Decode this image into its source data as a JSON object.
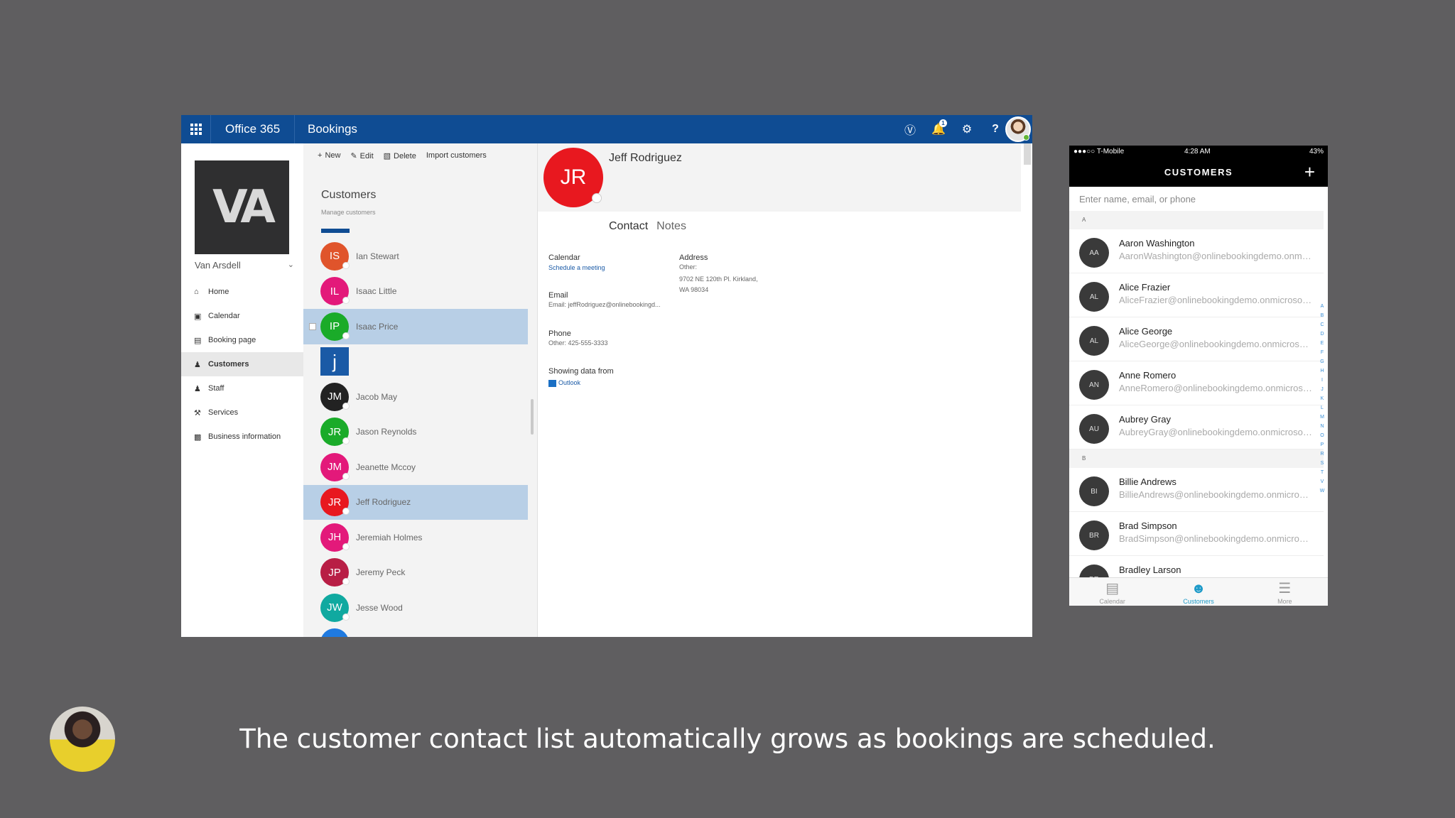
{
  "topbar": {
    "app_name": "Office 365",
    "service_name": "Bookings",
    "notifications_count": "1",
    "icons": [
      "skype-icon",
      "bell-icon",
      "gear-icon",
      "help-icon"
    ]
  },
  "business": {
    "logo_text": "VA",
    "name": "Van Arsdell"
  },
  "nav": {
    "items": [
      {
        "label": "Home",
        "icon": "home-icon"
      },
      {
        "label": "Calendar",
        "icon": "calendar-icon"
      },
      {
        "label": "Booking page",
        "icon": "booking-page-icon"
      },
      {
        "label": "Customers",
        "icon": "customers-icon",
        "active": true
      },
      {
        "label": "Staff",
        "icon": "staff-icon"
      },
      {
        "label": "Services",
        "icon": "services-icon"
      },
      {
        "label": "Business information",
        "icon": "business-info-icon"
      }
    ]
  },
  "commands": {
    "new": "New",
    "edit": "Edit",
    "delete": "Delete",
    "import": "Import customers"
  },
  "customer_list": {
    "title": "Customers",
    "subtitle": "Manage customers",
    "rows": [
      {
        "initials": "IS",
        "name": "Ian Stewart",
        "color": "#e0542b"
      },
      {
        "initials": "IL",
        "name": "Isaac Little",
        "color": "#e3197a"
      },
      {
        "initials": "IP",
        "name": "Isaac Price",
        "color": "#1aab29",
        "selected": true
      },
      {
        "letter": "j"
      },
      {
        "initials": "JM",
        "name": "Jacob May",
        "color": "#222222"
      },
      {
        "initials": "JR",
        "name": "Jason Reynolds",
        "color": "#1aab29"
      },
      {
        "initials": "JM",
        "name": "Jeanette Mccoy",
        "color": "#e3197a"
      },
      {
        "initials": "JR",
        "name": "Jeff Rodriguez",
        "color": "#e8181f",
        "selected": true
      },
      {
        "initials": "JH",
        "name": "Jeremiah Holmes",
        "color": "#e3197a"
      },
      {
        "initials": "JP",
        "name": "Jeremy Peck",
        "color": "#b81e45"
      },
      {
        "initials": "JW",
        "name": "Jesse Wood",
        "color": "#10a9a0"
      }
    ]
  },
  "detail": {
    "initials": "JR",
    "name": "Jeff Rodriguez",
    "tabs": [
      "Contact",
      "Notes"
    ],
    "calendar_label": "Calendar",
    "calendar_link": "Schedule a meeting",
    "address_label": "Address",
    "address_type": "Other:",
    "address_line1": "9702 NE 120th Pl. Kirkland,",
    "address_line2": "WA 98034",
    "email_label": "Email",
    "email_value": "Email: jeffRodriguez@onlinebookingd...",
    "phone_label": "Phone",
    "phone_value": "Other: 425-555-3333",
    "source_label": "Showing data from",
    "source_value": "Outlook"
  },
  "phone": {
    "carrier": "T-Mobile",
    "time": "4:28 AM",
    "battery": "43%",
    "title": "CUSTOMERS",
    "add": "+",
    "search_placeholder": "Enter name, email, or phone",
    "sections": [
      {
        "letter": "A",
        "rows": [
          {
            "initials": "AA",
            "name": "Aaron Washington",
            "email": "AaronWashington@onlinebookingdemo.onmicrosoft.com"
          },
          {
            "initials": "AL",
            "name": "Alice Frazier",
            "email": "AliceFrazier@onlinebookingdemo.onmicrosoft.com"
          },
          {
            "initials": "AL",
            "name": "Alice George",
            "email": "AliceGeorge@onlinebookingdemo.onmicrosoft.com"
          },
          {
            "initials": "AN",
            "name": "Anne Romero",
            "email": "AnneRomero@onlinebookingdemo.onmicrosoft.com"
          },
          {
            "initials": "AU",
            "name": "Aubrey Gray",
            "email": "AubreyGray@onlinebookingdemo.onmicrosoft.com"
          }
        ]
      },
      {
        "letter": "B",
        "rows": [
          {
            "initials": "BI",
            "name": "Billie Andrews",
            "email": "BillieAndrews@onlinebookingdemo.onmicrosoft.com"
          },
          {
            "initials": "BR",
            "name": "Brad Simpson",
            "email": "BradSimpson@onlinebookingdemo.onmicrosoft.com"
          },
          {
            "initials": "BR",
            "name": "Bradley Larson",
            "email": ""
          }
        ]
      }
    ],
    "index_letters": [
      "A",
      "B",
      "C",
      "D",
      "E",
      "F",
      "G",
      "H",
      "I",
      "J",
      "K",
      "L",
      "M",
      "N",
      "O",
      "P",
      "R",
      "S",
      "T",
      "V",
      "W"
    ],
    "tabs": [
      {
        "label": "Calendar",
        "icon": "calendar-icon"
      },
      {
        "label": "Customers",
        "icon": "person-icon",
        "active": true
      },
      {
        "label": "More",
        "icon": "menu-icon"
      }
    ]
  },
  "caption": "The customer contact list automatically grows as bookings are scheduled."
}
